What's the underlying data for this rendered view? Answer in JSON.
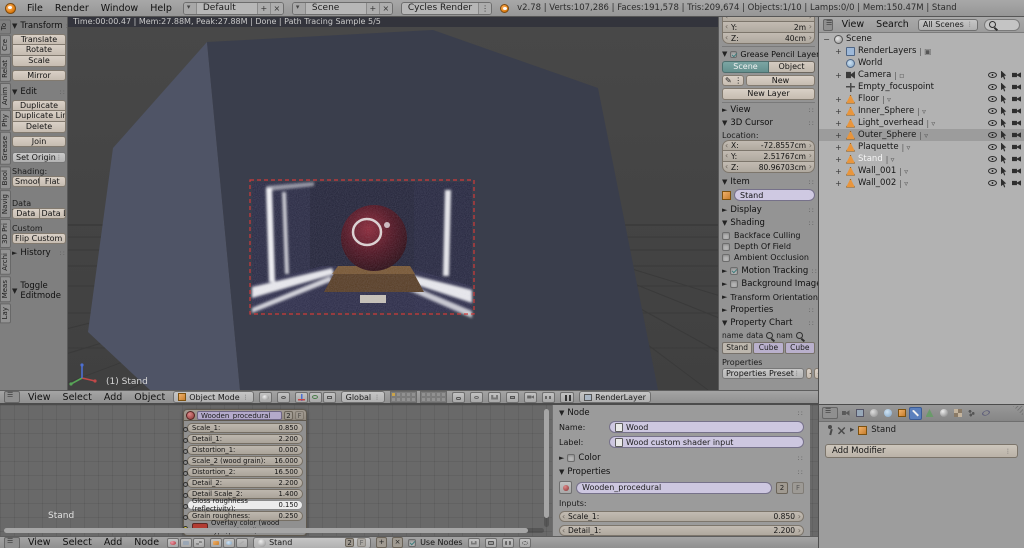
{
  "topbar": {
    "menus": [
      "File",
      "Render",
      "Window",
      "Help"
    ],
    "layout": "Default",
    "scene": "Scene",
    "engine": "Cycles Render",
    "stats": "v2.78 | Verts:107,286 | Faces:191,578 | Tris:209,674 | Objects:1/10 | Lamps:0/0 | Mem:150.47M | Stand"
  },
  "toolshelf": {
    "tabs": [
      {
        "label": "To",
        "active": true
      },
      {
        "label": "Cre"
      },
      {
        "label": "Relat"
      },
      {
        "label": "Anim"
      },
      {
        "label": "Phy"
      },
      {
        "label": "Grease"
      },
      {
        "label": "Bool"
      },
      {
        "label": "Navig"
      },
      {
        "label": "3D Pri"
      },
      {
        "label": "Archi"
      },
      {
        "label": "Meas"
      },
      {
        "label": "Lay"
      }
    ],
    "transform": {
      "title": "Transform",
      "translate": "Translate",
      "rotate": "Rotate",
      "scale": "Scale",
      "mirror": "Mirror"
    },
    "edit": {
      "title": "Edit",
      "duplicate": "Duplicate",
      "duplicate_link": "Duplicate Link...",
      "delete": "Delete",
      "join": "Join",
      "set_origin": "Set Origin"
    },
    "shading_label": "Shading:",
    "smooth": "Smoot",
    "flat": "Flat",
    "data_transfer_label": "Data Transfer:",
    "data": "Data",
    "data_layout": "Data La",
    "custom_normal_label": "Custom Normal",
    "flip_custom": "Flip Custom N...",
    "history": "History",
    "redo_panel": "Toggle Editmode"
  },
  "viewport": {
    "render_stats": "Time:00:00.47 | Mem:27.88M, Peak:27.88M | Done | Path Tracing Sample 5/5",
    "object_label": "(1) Stand",
    "header": {
      "menus": [
        "View",
        "Select",
        "Add",
        "Object"
      ],
      "mode": "Object Mode",
      "orientation": "Global",
      "render_layer": "RenderLayer"
    }
  },
  "npanel": {
    "dims": {
      "y_label": "Y:",
      "y": "2m",
      "z_label": "Z:",
      "z": "40cm"
    },
    "gp": {
      "title": "Grease Pencil Layers",
      "scene": "Scene",
      "object": "Object",
      "new": "New",
      "new_layer": "New Layer"
    },
    "view_title": "View",
    "cursor": {
      "title": "3D Cursor",
      "location_label": "Location:",
      "x_label": "X:",
      "x": "-72.8557cm",
      "y_label": "Y:",
      "y": "2.51767cm",
      "z_label": "Z:",
      "z": "80.96703cm"
    },
    "item": {
      "title": "Item",
      "name": "Stand"
    },
    "display_title": "Display",
    "shading": {
      "title": "Shading",
      "options": [
        "Backface Culling",
        "Depth Of Field",
        "Ambient Occlusion"
      ]
    },
    "motion_tracking": "Motion Tracking",
    "background_images": "Background Images",
    "transform_orientations": "Transform Orientations",
    "properties_title": "Properties",
    "property_chart": {
      "title": "Property Chart",
      "col1": "name",
      "col2": "data",
      "col3": "nam",
      "cells": [
        "Stand",
        "Cube",
        "Cube"
      ],
      "props_label": "Properties",
      "preset": "Properties Preset"
    }
  },
  "outliner": {
    "header": {
      "view": "View",
      "search": "Search",
      "filter": "All Scenes"
    },
    "items": [
      {
        "label": "Scene",
        "depth": 0,
        "icon": "scene",
        "exp": "−",
        "toggles": false
      },
      {
        "label": "RenderLayers",
        "depth": 1,
        "icon": "renderlayer",
        "exp": "+",
        "suffix": "▣",
        "toggles": false
      },
      {
        "label": "World",
        "depth": 1,
        "icon": "world",
        "exp": "",
        "toggles": false
      },
      {
        "label": "Camera",
        "depth": 1,
        "icon": "camera",
        "exp": "+",
        "suffix": "▫",
        "toggles": true
      },
      {
        "label": "Empty_focuspoint",
        "depth": 1,
        "icon": "empty",
        "exp": "",
        "toggles": true
      },
      {
        "label": "Floor",
        "depth": 1,
        "icon": "mesh",
        "exp": "+",
        "suffix": "▿",
        "toggles": true
      },
      {
        "label": "Inner_Sphere",
        "depth": 1,
        "icon": "mesh",
        "exp": "+",
        "suffix": "▿",
        "toggles": true
      },
      {
        "label": "Light_overhead",
        "depth": 1,
        "icon": "mesh",
        "exp": "+",
        "suffix": "▿",
        "toggles": true
      },
      {
        "label": "Outer_Sphere",
        "depth": 1,
        "icon": "mesh",
        "exp": "+",
        "suffix": "▿",
        "toggles": true,
        "selected": true
      },
      {
        "label": "Plaquette",
        "depth": 1,
        "icon": "mesh",
        "exp": "+",
        "suffix": "▿",
        "toggles": true
      },
      {
        "label": "Stand",
        "depth": 1,
        "icon": "mesh",
        "exp": "+",
        "suffix": "▿",
        "toggles": true,
        "active": true
      },
      {
        "label": "Wall_001",
        "depth": 1,
        "icon": "mesh",
        "exp": "+",
        "suffix": "▿",
        "toggles": true
      },
      {
        "label": "Wall_002",
        "depth": 1,
        "icon": "mesh",
        "exp": "+",
        "suffix": "▿",
        "toggles": true
      }
    ]
  },
  "node_editor": {
    "backdrop_label": "Stand",
    "node": {
      "title": "Wooden_procedural",
      "users": "2",
      "fake": "F",
      "inputs": [
        {
          "label": "Scale_1:",
          "value": "0.850"
        },
        {
          "label": "Detail_1:",
          "value": "2.200"
        },
        {
          "label": "Distortion_1:",
          "value": "0.000"
        },
        {
          "label": "Scale_2 (wood grain):",
          "value": "16.000"
        },
        {
          "label": "Distortion_2:",
          "value": "16.500"
        },
        {
          "label": "Detail_2:",
          "value": "2.200"
        },
        {
          "label": "Detail Scale_2:",
          "value": "1.400"
        },
        {
          "label": "Gloss roughness (reflectivity):",
          "value": "0.150",
          "selected": true
        },
        {
          "label": "Grain roughness:",
          "value": "0.250"
        },
        {
          "label": "Overlay color (wood type/painted)",
          "value": "",
          "color": "#b23c32"
        }
      ]
    },
    "npanel": {
      "node_title": "Node",
      "name_label": "Name:",
      "name": "Wood",
      "label_label": "Label:",
      "label": "Wood custom shader input",
      "color_title": "Color",
      "properties_title": "Properties",
      "group": "Wooden_procedural",
      "users": "2",
      "fake": "F",
      "inputs_label": "Inputs:",
      "rows": [
        {
          "label": "Scale_1:",
          "value": "0.850"
        },
        {
          "label": "Detail_1:",
          "value": "2.200"
        }
      ]
    },
    "header": {
      "menus": [
        "View",
        "Select",
        "Add",
        "Node"
      ],
      "material": "Stand",
      "users": "2",
      "fake": "F",
      "use_nodes": "Use Nodes"
    }
  },
  "properties_editor": {
    "breadcrumb_object": "Stand",
    "add_modifier": "Add Modifier"
  },
  "colors": {
    "active_tab_blue": "#5b80bd",
    "mesh_icon_orange": "#e8953c",
    "overlay_swatch_red": "#b23c32",
    "render_border_red": "#cf3a3a",
    "scene_toggle_teal": "#6f9c9c",
    "datablock_field_lavender": "#cdc7e0"
  }
}
